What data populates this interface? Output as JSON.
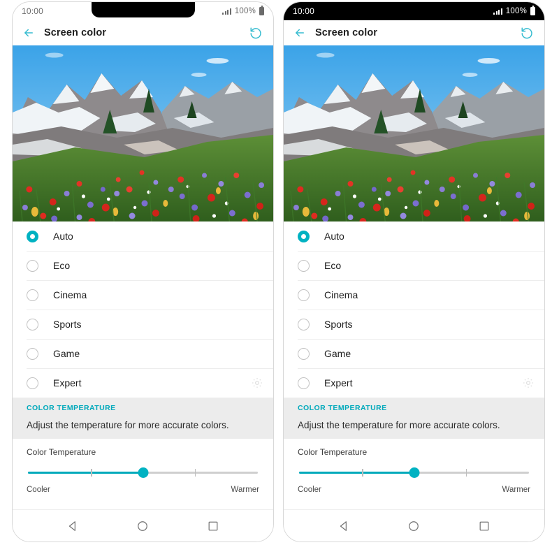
{
  "meta": {
    "accent": "#00b2c2",
    "accent_dark": "#00a9bb",
    "variants": [
      "notch-phone",
      "flat-phone"
    ]
  },
  "status_bar": {
    "time": "10:00",
    "battery_percent": "100%",
    "signal_icon": "signal-bars-icon",
    "battery_icon": "battery-full-icon"
  },
  "app_bar": {
    "back_icon": "back-arrow-icon",
    "title": "Screen color",
    "reset_icon": "reset-undo-icon"
  },
  "preview": {
    "alt": "Mountain wildflower meadow preview image",
    "name": "color-preview-image"
  },
  "options": {
    "selected": "Auto",
    "items": [
      {
        "label": "Auto",
        "selected": true,
        "has_settings": false
      },
      {
        "label": "Eco",
        "selected": false,
        "has_settings": false
      },
      {
        "label": "Cinema",
        "selected": false,
        "has_settings": false
      },
      {
        "label": "Sports",
        "selected": false,
        "has_settings": false
      },
      {
        "label": "Game",
        "selected": false,
        "has_settings": false
      },
      {
        "label": "Expert",
        "selected": false,
        "has_settings": true
      }
    ],
    "settings_icon": "gear-icon"
  },
  "color_temperature": {
    "section_title": "COLOR TEMPERATURE",
    "description": "Adjust the temperature for more accurate colors.",
    "slider_label": "Color Temperature",
    "min_label": "Cooler",
    "max_label": "Warmer",
    "value_percent": 50,
    "ticks": [
      27.5,
      72.5
    ]
  },
  "nav_bar": {
    "back": "nav-back-icon",
    "home": "nav-home-icon",
    "recents": "nav-recents-icon"
  }
}
